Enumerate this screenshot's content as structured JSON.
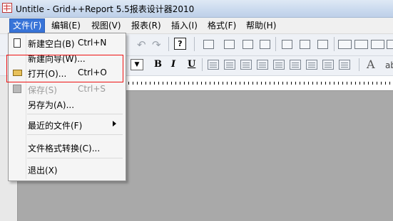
{
  "window": {
    "title": "Untitle - Grid++Report 5.5报表设计器2010"
  },
  "menubar": {
    "items": [
      {
        "label": "文件(F)",
        "name": "menu-file",
        "active": true
      },
      {
        "label": "编辑(E)",
        "name": "menu-edit"
      },
      {
        "label": "视图(V)",
        "name": "menu-view"
      },
      {
        "label": "报表(R)",
        "name": "menu-report"
      },
      {
        "label": "插入(I)",
        "name": "menu-insert"
      },
      {
        "label": "格式(F)",
        "name": "menu-format"
      },
      {
        "label": "帮助(H)",
        "name": "menu-help"
      }
    ]
  },
  "toolbar": {
    "help_label": "?",
    "font_sample": "A",
    "font_sample_small": "ab"
  },
  "format": {
    "bold": "B",
    "italic": "I",
    "underline": "U"
  },
  "file_menu": {
    "items": [
      {
        "label": "新建空白(B)",
        "shortcut": "Ctrl+N",
        "icon": "new-document-icon"
      },
      {
        "label": "新建向导(W)...",
        "shortcut": ""
      },
      {
        "label": "打开(O)...",
        "shortcut": "Ctrl+O",
        "icon": "open-folder-icon"
      },
      {
        "label": "保存(S)",
        "shortcut": "Ctrl+S",
        "icon": "save-disk-icon",
        "disabled": true
      },
      {
        "label": "另存为(A)...",
        "shortcut": ""
      },
      {
        "label": "最近的文件(F)",
        "shortcut": "",
        "submenu": true
      },
      {
        "label": "文件格式转换(C)...",
        "shortcut": ""
      },
      {
        "label": "退出(X)",
        "shortcut": ""
      }
    ]
  },
  "colors": {
    "highlight_box": "#e11111",
    "menu_active": "#3874d8"
  }
}
